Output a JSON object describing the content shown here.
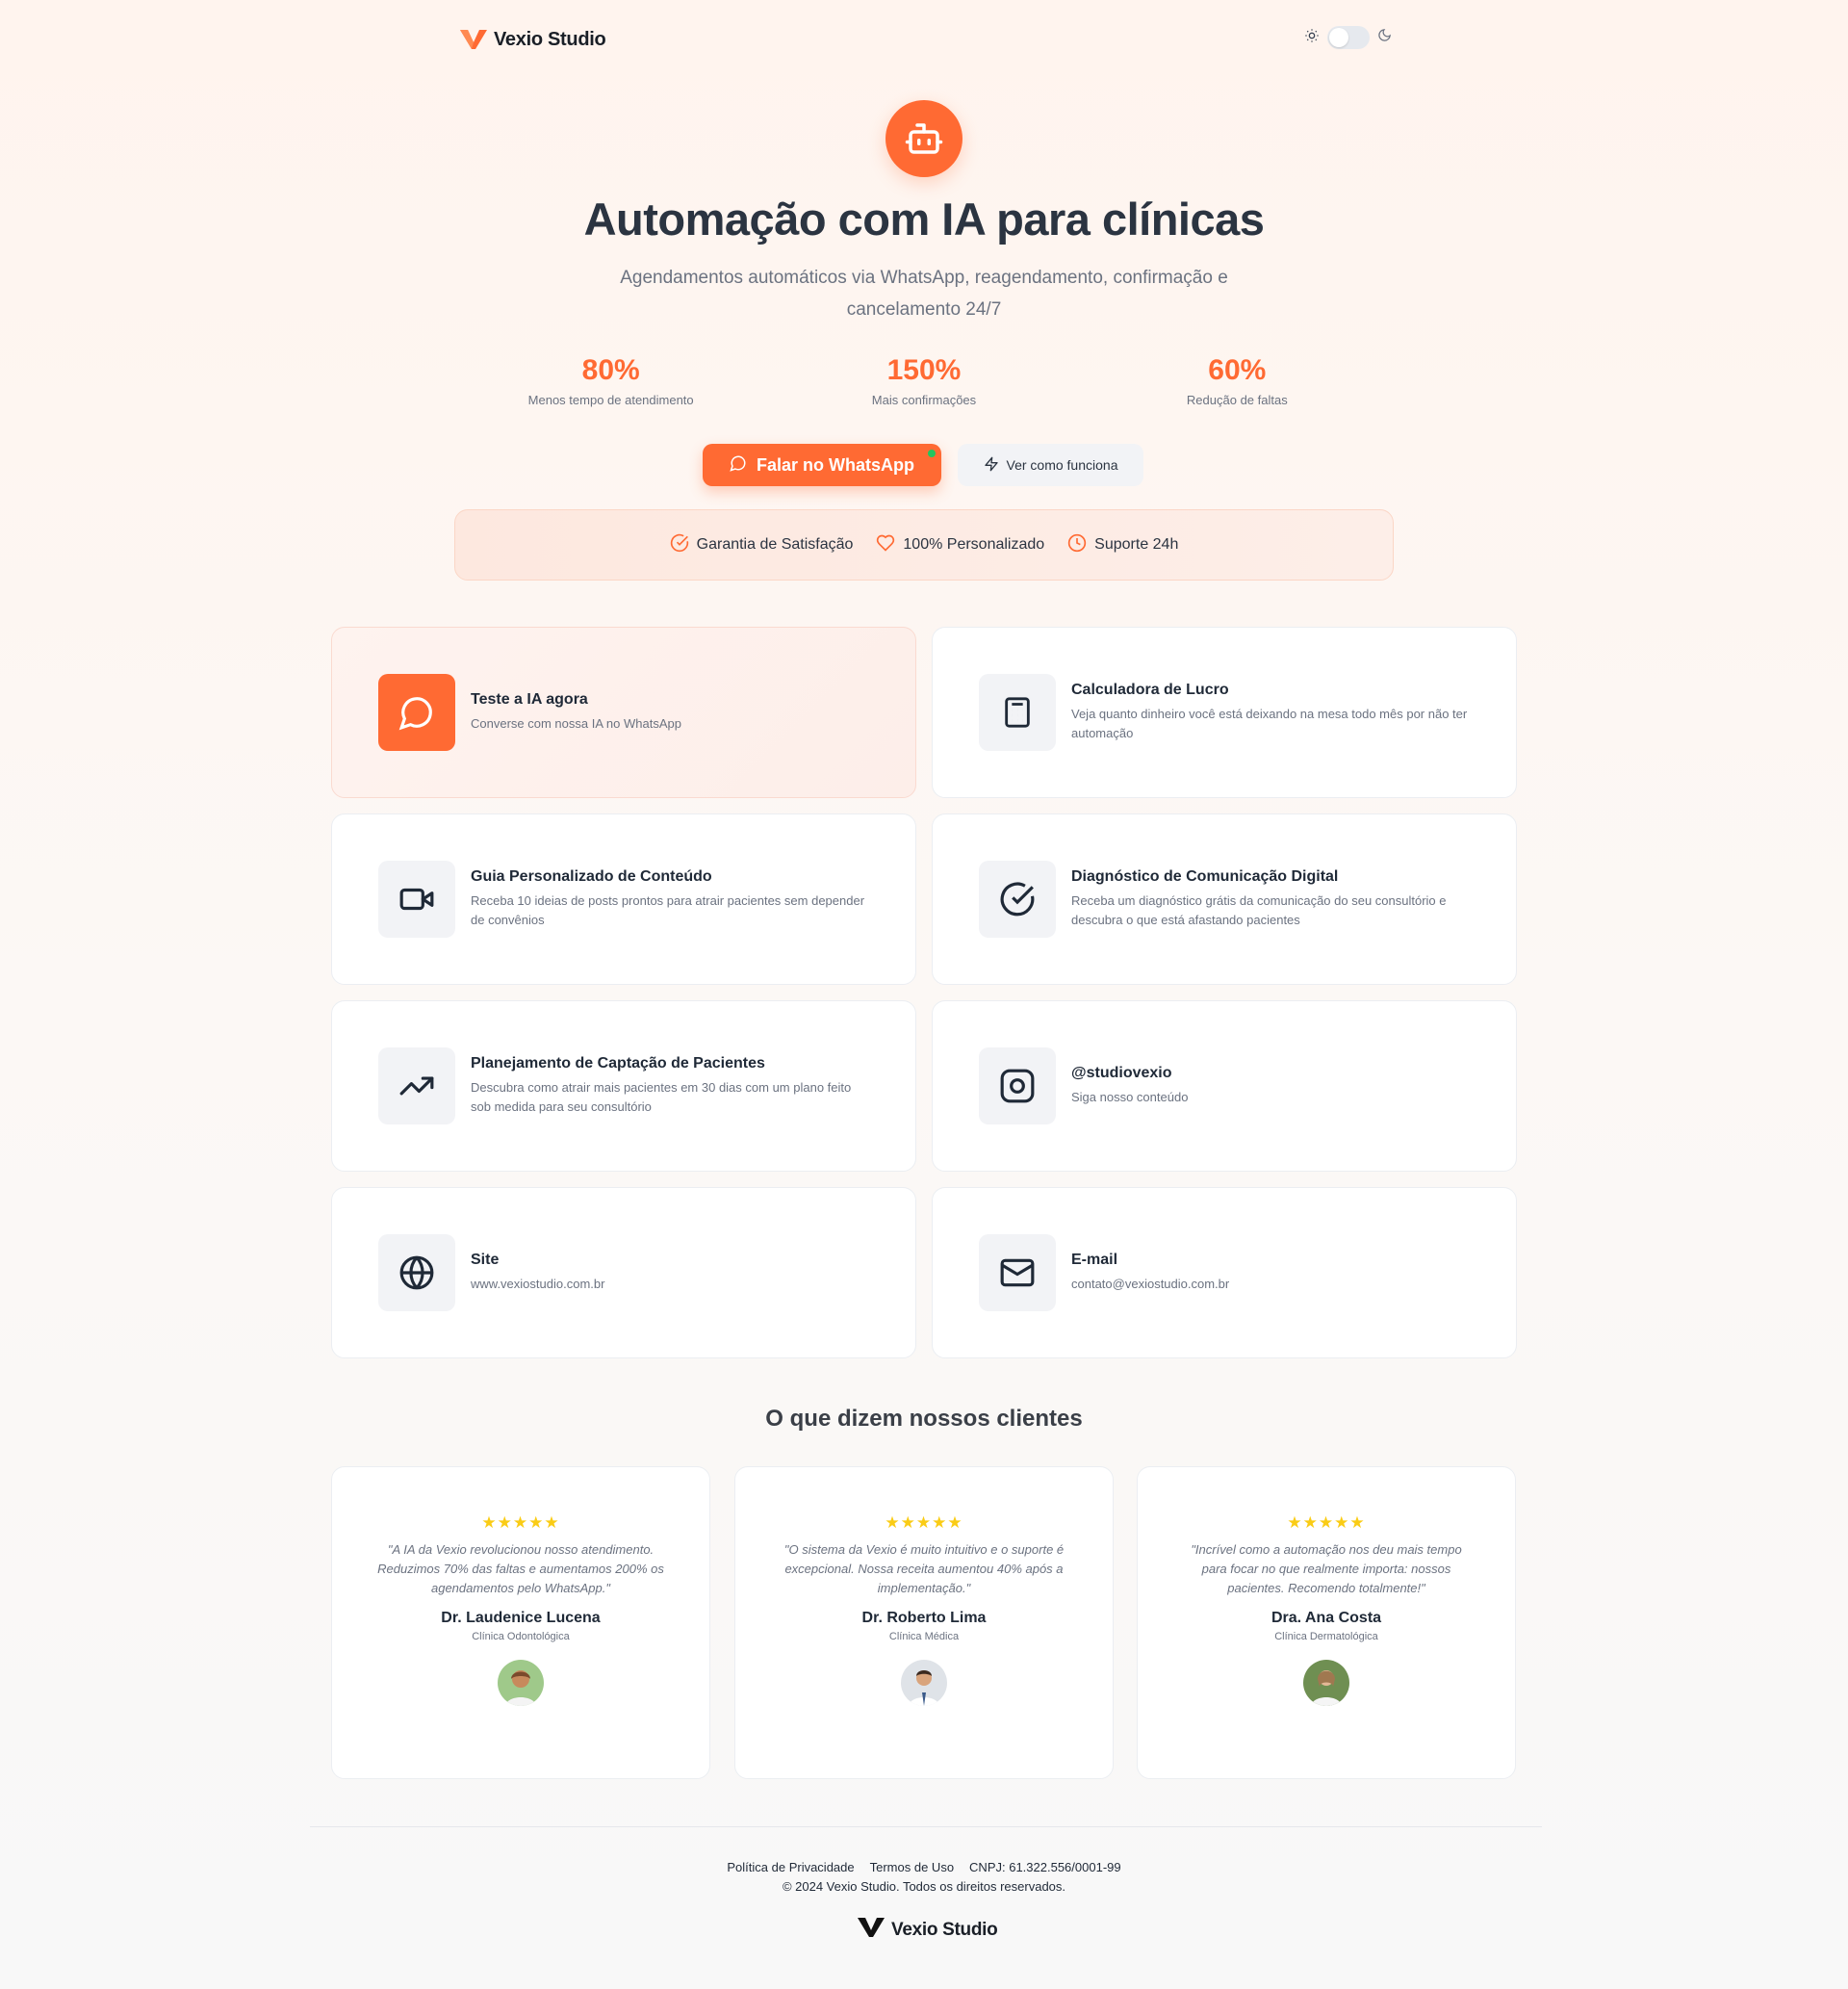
{
  "header": {
    "brand": "Vexio Studio",
    "theme_toggle": {
      "light_icon": "sun-icon",
      "dark_icon": "moon-icon",
      "state": "light"
    }
  },
  "hero": {
    "icon": "bot-icon",
    "title": "Automação com IA para clínicas",
    "subtitle": "Agendamentos automáticos via WhatsApp, reagendamento, confirmação e cancelamento 24/7",
    "stats": [
      {
        "value": "80%",
        "label": "Menos tempo de atendimento"
      },
      {
        "value": "150%",
        "label": "Mais confirmações"
      },
      {
        "value": "60%",
        "label": "Redução de faltas"
      }
    ],
    "primary_button": "Falar no WhatsApp",
    "secondary_button": "Ver como funciona",
    "badges": [
      {
        "icon": "check-circle-icon",
        "label": "Garantia de Satisfação"
      },
      {
        "icon": "heart-icon",
        "label": "100% Personalizado"
      },
      {
        "icon": "clock-icon",
        "label": "Suporte 24h"
      }
    ]
  },
  "cards": [
    {
      "icon": "chat-bubble-icon",
      "title": "Teste a IA agora",
      "desc": "Converse com nossa IA no WhatsApp"
    },
    {
      "icon": "calculator-icon",
      "title": "Calculadora de Lucro",
      "desc": "Veja quanto dinheiro você está deixando na mesa todo mês por não ter automação"
    },
    {
      "icon": "video-icon",
      "title": "Guia Personalizado de Conteúdo",
      "desc": "Receba 10 ideias de posts prontos para atrair pacientes sem depender de convênios"
    },
    {
      "icon": "check-circle-icon",
      "title": "Diagnóstico de Comunicação Digital",
      "desc": "Receba um diagnóstico grátis da comunicação do seu consultório e descubra o que está afastando pacientes"
    },
    {
      "icon": "trending-up-icon",
      "title": "Planejamento de Captação de Pacientes",
      "desc": "Descubra como atrair mais pacientes em 30 dias com um plano feito sob medida para seu consultório"
    },
    {
      "icon": "instagram-icon",
      "title": "@studiovexio",
      "desc": "Siga nosso conteúdo"
    },
    {
      "icon": "globe-icon",
      "title": "Site",
      "desc": "www.vexiostudio.com.br"
    },
    {
      "icon": "mail-icon",
      "title": "E-mail",
      "desc": "contato@vexiostudio.com.br"
    }
  ],
  "testimonials": {
    "title": "O que dizem nossos clientes",
    "items": [
      {
        "stars": "★★★★★",
        "quote": "\"A IA da Vexio revolucionou nosso atendimento. Reduzimos 70% das faltas e aumentamos 200% os agendamentos pelo WhatsApp.\"",
        "name": "Dr. Laudenice Lucena",
        "role": "Clínica Odontológica"
      },
      {
        "stars": "★★★★★",
        "quote": "\"O sistema da Vexio é muito intuitivo e o suporte é excepcional. Nossa receita aumentou 40% após a implementação.\"",
        "name": "Dr. Roberto Lima",
        "role": "Clínica Médica"
      },
      {
        "stars": "★★★★★",
        "quote": "\"Incrível como a automação nos deu mais tempo para focar no que realmente importa: nossos pacientes. Recomendo totalmente!\"",
        "name": "Dra. Ana Costa",
        "role": "Clínica Dermatológica"
      }
    ]
  },
  "footer": {
    "links": [
      "Política de Privacidade",
      "Termos de Uso"
    ],
    "cnpj": "CNPJ: 61.322.556/0001-99",
    "copyright": "© 2024 Vexio Studio. Todos os direitos reservados.",
    "brand": "Vexio Studio"
  },
  "colors": {
    "accent": "#ff6a33",
    "text": "#2b3441",
    "muted": "#6b7280",
    "online": "#22c55e",
    "star": "#facc15"
  }
}
